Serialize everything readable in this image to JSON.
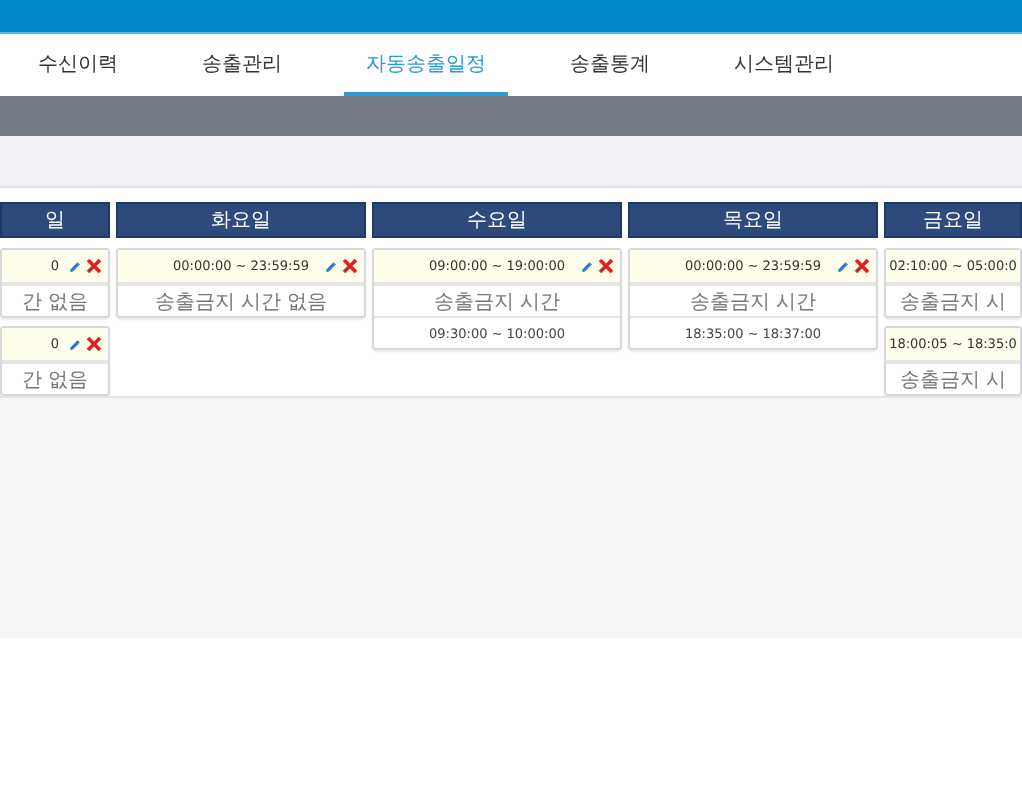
{
  "nav": {
    "tabs": [
      {
        "label": "수신이력",
        "selected": false
      },
      {
        "label": "송출관리",
        "selected": false
      },
      {
        "label": "자동송출일정",
        "selected": true
      },
      {
        "label": "송출통계",
        "selected": false
      },
      {
        "label": "시스템관리",
        "selected": false
      }
    ]
  },
  "days": [
    {
      "header": "일",
      "cards": [
        {
          "time": "0",
          "editable": true,
          "rows": [
            "간 없음"
          ]
        },
        {
          "time": "0",
          "editable": true,
          "rows": [
            "간 없음"
          ]
        }
      ]
    },
    {
      "header": "화요일",
      "cards": [
        {
          "time": "00:00:00 ~ 23:59:59",
          "editable": true,
          "rows": [
            "송출금지 시간 없음"
          ]
        }
      ]
    },
    {
      "header": "수요일",
      "cards": [
        {
          "time": "09:00:00 ~ 19:00:00",
          "editable": true,
          "rows": [
            "송출금지 시간",
            "09:30:00 ~ 10:00:00"
          ]
        }
      ]
    },
    {
      "header": "목요일",
      "cards": [
        {
          "time": "00:00:00 ~ 23:59:59",
          "editable": true,
          "rows": [
            "송출금지 시간",
            "18:35:00 ~ 18:37:00"
          ]
        }
      ]
    },
    {
      "header": "금요일",
      "cards": [
        {
          "time": "02:10:00 ~ 05:00:0",
          "editable": false,
          "rows": [
            "송출금지 시"
          ]
        },
        {
          "time": "18:00:05 ~ 18:35:0",
          "editable": false,
          "rows": [
            "송출금지 시"
          ]
        }
      ]
    }
  ]
}
